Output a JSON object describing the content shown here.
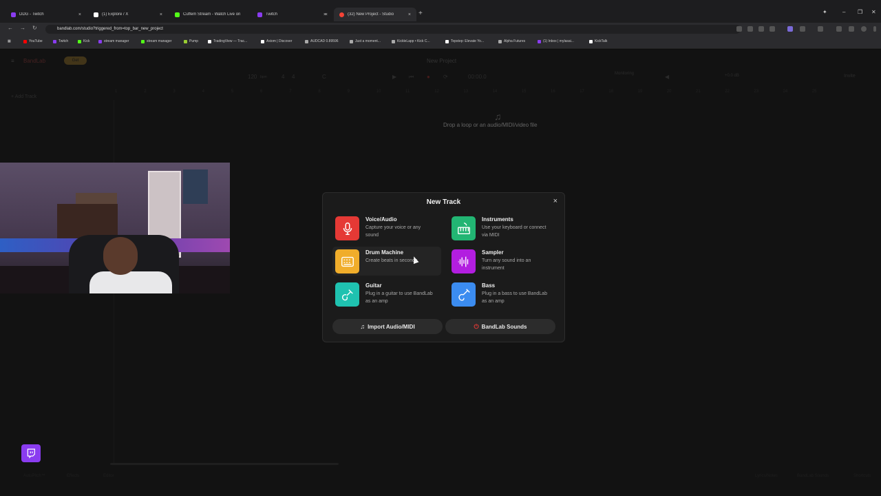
{
  "browser": {
    "tabs": [
      {
        "label": "DDG - Twitch",
        "color": "#8a3cf0"
      },
      {
        "label": "(1) Explore / X",
        "color": "#ffffff"
      },
      {
        "label": "Cuffem Stream - Watch Live on",
        "color": "#53fc18"
      },
      {
        "label": "Twitch",
        "color": "#8a3cf0"
      },
      {
        "label": "(32) New Project - Studio",
        "color": "#f44336"
      }
    ],
    "new_tab_label": "+",
    "url": "bandlab.com/studio?triggered_from=top_bar_new_project",
    "bookmarks": [
      {
        "label": "YouTube",
        "color": "#ff0000"
      },
      {
        "label": "Twitch",
        "color": "#8a3cf0"
      },
      {
        "label": "Kick",
        "color": "#53fc18"
      },
      {
        "label": "stream manager",
        "color": "#8a3cf0"
      },
      {
        "label": "stream manager",
        "color": "#53fc18"
      },
      {
        "label": "Pump",
        "color": "#9acd32"
      },
      {
        "label": "TradingView — Trac...",
        "color": "#ffffff"
      },
      {
        "label": "Axiom | Discover",
        "color": "#ffffff"
      },
      {
        "label": "AUDCAD 0.89596",
        "color": "#aaaaaa"
      },
      {
        "label": "Just a moment...",
        "color": "#aaaaaa"
      },
      {
        "label": "KickleLapp • Kick C...",
        "color": "#aaaaaa"
      },
      {
        "label": "Topstep: Elevate Yo...",
        "color": "#ffffff"
      },
      {
        "label": "Alpha Futures",
        "color": "#aaaaaa"
      },
      {
        "label": "(1) Inbox | mylasai...",
        "color": "#8a3cf0"
      },
      {
        "label": "KickTalk",
        "color": "#ffffff"
      }
    ]
  },
  "studio": {
    "logo": "BandLab",
    "get_badge": "Get",
    "project_title": "New Project",
    "tempo": "120",
    "tempo_unit": "bpm",
    "time_sig_top": "4",
    "time_sig_bottom": "4",
    "key": "C",
    "time_display": "00:00.0",
    "monitoring": "Monitoring",
    "volume_db": "+0.0 dB",
    "invite": "Invite",
    "add_track": "Add Track",
    "drop_hint": "Drop a loop or an audio/MIDI/video file",
    "ruler": [
      "1",
      "2",
      "3",
      "4",
      "5",
      "6",
      "7",
      "8",
      "9",
      "10",
      "11",
      "12",
      "13",
      "14",
      "15",
      "16",
      "17",
      "18",
      "19",
      "20",
      "21",
      "22",
      "23",
      "24",
      "25"
    ],
    "footer_left": [
      "AutoPitch™",
      "Effects",
      "Editor"
    ],
    "footer_right": [
      "Lyrics/Notes",
      "BandLab Sounds",
      "Shortcuts"
    ]
  },
  "modal": {
    "title": "New Track",
    "close_label": "×",
    "options": [
      {
        "title": "Voice/Audio",
        "desc": "Capture your voice or any sound",
        "color": "#e53935",
        "icon": "microphone-icon"
      },
      {
        "title": "Instruments",
        "desc": "Use your keyboard or connect via MIDI",
        "color": "#22b573",
        "icon": "keyboard-icon"
      },
      {
        "title": "Drum Machine",
        "desc": "Create beats in seconds",
        "color": "#f0ad2b",
        "icon": "drum-machine-icon"
      },
      {
        "title": "Sampler",
        "desc": "Turn any sound into an instrument",
        "color": "#b21ee0",
        "icon": "waveform-icon"
      },
      {
        "title": "Guitar",
        "desc": "Plug in a guitar to use BandLab as an amp",
        "color": "#1fc2b0",
        "icon": "guitar-icon"
      },
      {
        "title": "Bass",
        "desc": "Plug in a bass to use BandLab as an amp",
        "color": "#3b8cf0",
        "icon": "bass-icon"
      }
    ],
    "import_label": "Import Audio/MIDI",
    "sounds_label": "BandLab Sounds"
  }
}
